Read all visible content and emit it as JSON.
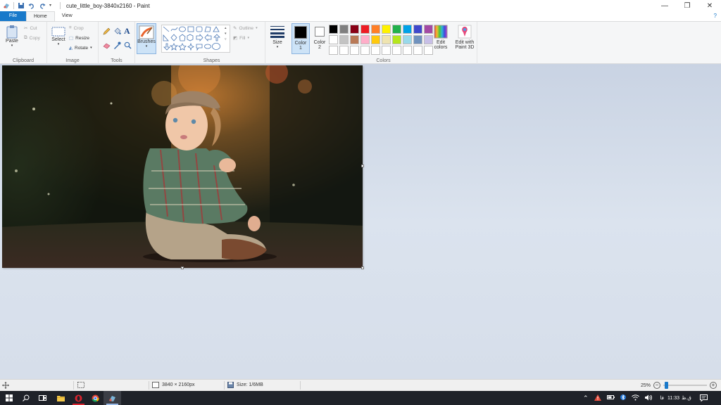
{
  "window": {
    "title": "cute_little_boy-3840x2160 - Paint"
  },
  "tabs": [
    "File",
    "Home",
    "View"
  ],
  "ribbon": {
    "clipboard": {
      "label": "Clipboard",
      "paste": "Paste",
      "cut": "Cut",
      "copy": "Copy"
    },
    "image": {
      "label": "Image",
      "select": "Select",
      "crop": "Crop",
      "resize": "Resize",
      "rotate": "Rotate"
    },
    "tools": {
      "label": "Tools"
    },
    "brushes": {
      "label": "Brushes"
    },
    "shapes": {
      "label": "Shapes",
      "outline": "Outline",
      "fill": "Fill"
    },
    "size": {
      "label": "Size"
    },
    "colors": {
      "label": "Colors",
      "color1": "Color",
      "color1_num": "1",
      "color2": "Color",
      "color2_num": "2",
      "edit_colors_1": "Edit",
      "edit_colors_2": "colors",
      "paint3d_1": "Edit with",
      "paint3d_2": "Paint 3D",
      "color1_value": "#000000",
      "color2_value": "#ffffff",
      "palette_row1": [
        "#000000",
        "#7f7f7f",
        "#880015",
        "#ed1c24",
        "#ff7f27",
        "#fff200",
        "#22b14c",
        "#00a2e8",
        "#3f48cc",
        "#a349a4"
      ],
      "palette_row2": [
        "#ffffff",
        "#c3c3c3",
        "#b97a57",
        "#ffaec9",
        "#ffc90e",
        "#efe4b0",
        "#b5e61d",
        "#99d9ea",
        "#7092be",
        "#c8bfe7"
      ],
      "palette_row3": [
        "#ffffff",
        "#ffffff",
        "#ffffff",
        "#ffffff",
        "#ffffff",
        "#ffffff",
        "#ffffff",
        "#ffffff",
        "#ffffff",
        "#ffffff"
      ]
    }
  },
  "statusbar": {
    "dimensions": "3840 × 2160px",
    "size": "Size: 1/6MB",
    "zoom": "25%"
  },
  "taskbar": {
    "time": "11:33",
    "ampm": "ق.ظ",
    "lang": "فا"
  }
}
